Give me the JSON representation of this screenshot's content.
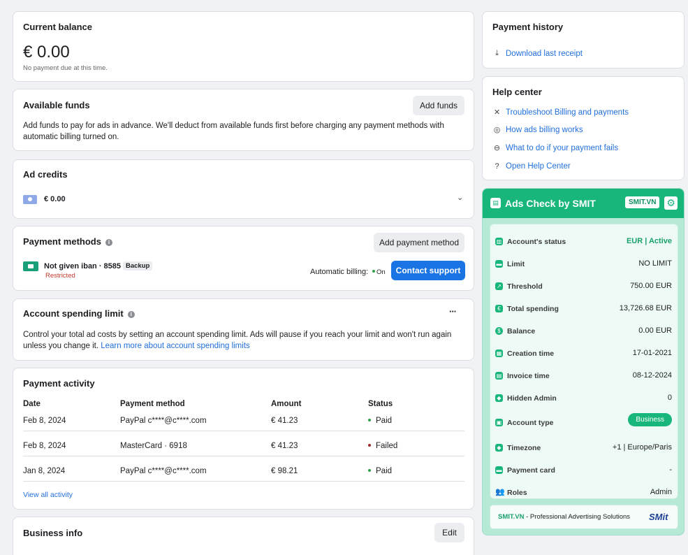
{
  "balance": {
    "title": "Current balance",
    "amount": "€ 0.00",
    "note": "No payment due at this time."
  },
  "funds": {
    "title": "Available funds",
    "button": "Add funds",
    "desc1": "Add funds to pay for ads in advance. We'll deduct from available funds first before charging any payment methods with",
    "desc2": "automatic billing turned on."
  },
  "credits": {
    "title": "Ad credits",
    "amount": "€ 0.00"
  },
  "methods": {
    "title": "Payment methods",
    "add_button": "Add payment method",
    "card_name": "Not given iban · 8585",
    "card_badge": "Backup",
    "card_status": "Restricted",
    "auto_label": "Automatic billing:",
    "auto_value": "On",
    "contact_button": "Contact support"
  },
  "spending": {
    "title": "Account spending limit",
    "menu": "···",
    "desc1": "Control your total ad costs by setting an account spending limit. Ads will pause if you reach your limit and won't run again",
    "desc2": "unless you change it.",
    "link": "Learn more about account spending limits"
  },
  "activity": {
    "title": "Payment activity",
    "headers": [
      "Date",
      "Payment method",
      "Amount",
      "Status"
    ],
    "rows": [
      {
        "date": "Feb 8, 2024",
        "method": "PayPal c****@c****.com",
        "amount": "€ 41.23",
        "status": "Paid",
        "status_color": "#31a24c"
      },
      {
        "date": "Feb 8, 2024",
        "method": "MasterCard · 6918",
        "amount": "€ 41.23",
        "status": "Failed",
        "status_color": "#a02727"
      },
      {
        "date": "Jan 8, 2024",
        "method": "PayPal c****@c****.com",
        "amount": "€ 98.21",
        "status": "Paid",
        "status_color": "#31a24c"
      }
    ],
    "view_all": "View all activity"
  },
  "business": {
    "title": "Business info",
    "edit": "Edit"
  },
  "history": {
    "title": "Payment history",
    "download": "Download last receipt"
  },
  "help": {
    "title": "Help center",
    "items": [
      {
        "label": "Troubleshoot Billing and payments",
        "icon": "wrench-icon"
      },
      {
        "label": "How ads billing works",
        "icon": "bag-icon"
      },
      {
        "label": "What to do if your payment fails",
        "icon": "minus-circle-icon"
      },
      {
        "label": "Open Help Center",
        "icon": "question-icon"
      }
    ]
  },
  "smit": {
    "title": "Ads Check by SMIT",
    "badge": "SMIT.VN",
    "rows": [
      {
        "label": "Account's status",
        "value": "EUR | Active"
      },
      {
        "label": "Limit",
        "value": "NO LIMIT"
      },
      {
        "label": "Threshold",
        "value": "750.00 EUR"
      },
      {
        "label": "Total spending",
        "value": "13,726.68 EUR"
      },
      {
        "label": "Balance",
        "value": "0.00 EUR"
      },
      {
        "label": "Creation time",
        "value": "17-01-2021"
      },
      {
        "label": "Invoice time",
        "value": "08-12-2024"
      },
      {
        "label": "Hidden Admin",
        "value": "0"
      },
      {
        "label": "Account type",
        "value": "Business"
      },
      {
        "label": "Timezone",
        "value": "+1 | Europe/Paris"
      },
      {
        "label": "Payment card",
        "value": "-"
      },
      {
        "label": "Roles",
        "value": "Admin"
      }
    ],
    "footer_brand": "SMIT.VN",
    "footer_text": " - Professional Advertising Solutions",
    "footer_logo": "SMit",
    "accent": "#19b67c"
  }
}
